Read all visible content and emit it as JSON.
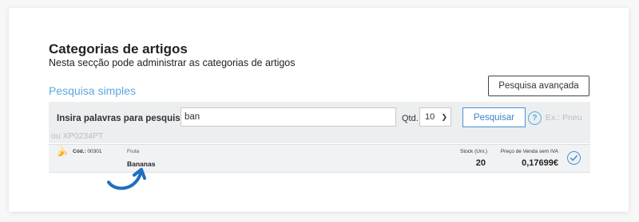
{
  "header": {
    "title": "Categorias de artigos",
    "subtitle": "Nesta secção pode administrar as categorias de artigos"
  },
  "search": {
    "simple_label": "Pesquisa simples",
    "advanced_button": "Pesquisa avançada",
    "input_label": "Insira palavras para pesquisar",
    "input_value": "ban",
    "qtd_label": "Qtd.",
    "qtd_value": "10",
    "submit_label": "Pesquisar",
    "help_symbol": "?",
    "hint_part1": "Ex.: Pneu",
    "hint_part2": "ou XP0234PT"
  },
  "result": {
    "code_label": "Cód.:",
    "code_value": "00301",
    "category": "Fruta",
    "name": "Bananas",
    "stock_label": "Stock (Uni.)",
    "stock_value": "20",
    "price_label": "Preço de Venda sem IVA",
    "price_value": "0,17699€",
    "icon": "banana-icon"
  },
  "colors": {
    "accent": "#4a90d6",
    "link": "#5aa8df",
    "panel": "#eceef0"
  }
}
